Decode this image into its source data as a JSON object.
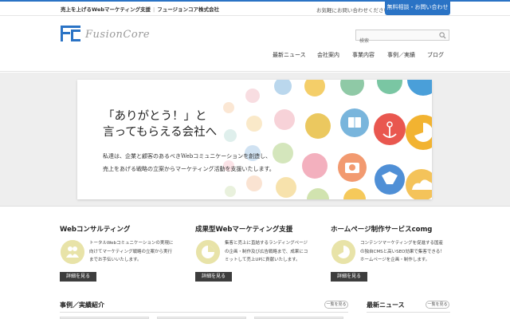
{
  "topbar": {
    "tagline": "売上を上げるWebマーケティング支援",
    "company": "フュージョンコア株式会社",
    "contact_note": "お気軽にお問い合わせください",
    "cta_label": "無料相談・お問い合わせ"
  },
  "header": {
    "logo_text": "FusionCore",
    "search_placeholder": "検索",
    "nav": [
      "最新ニュース",
      "会社案内",
      "事業内容",
      "事例／実績",
      "ブログ"
    ]
  },
  "hero": {
    "headline_line1": "「ありがとう！」と",
    "headline_line2": "言ってもらえる会社へ",
    "copy_line1": "私達は、企業と顧客のあるべきWebコミュニケーションを創造し、",
    "copy_line2": "売上をあげる戦略の立案からマーケティング活動を支援いたします。"
  },
  "services": [
    {
      "title": "Webコンサルティング",
      "lines": [
        "トータルWebコミュニケーションの実現に",
        "向けてマーケティング戦略の立案から実行",
        "までお手伝いいたします。"
      ],
      "button": "詳細を見る"
    },
    {
      "title": "成果型Webマーケティング支援",
      "lines": [
        "集客と売上に直結するランディングページ",
        "の企画・制作及び広告戦略まで、成果にコ",
        "ミットして売上UPに貢献いたします。"
      ],
      "button": "詳細を見る"
    },
    {
      "title": "ホームページ制作サービスcomg",
      "lines": [
        "コンテンツマーケティングを促進する国産",
        "の独自CMSと高いSEO効果で集客できる！",
        "ホームページを企画・制作します。"
      ],
      "button": "詳細を見る"
    }
  ],
  "sections": {
    "cases_title": "事例／実績紹介",
    "cases_more": "一覧を見る",
    "news_title": "最新ニュース",
    "news_more": "一覧を見る"
  },
  "colors": {
    "accent": "#2a73c5",
    "icon_bg": "#e8e3a8",
    "button_dark": "#3d3d3d"
  }
}
